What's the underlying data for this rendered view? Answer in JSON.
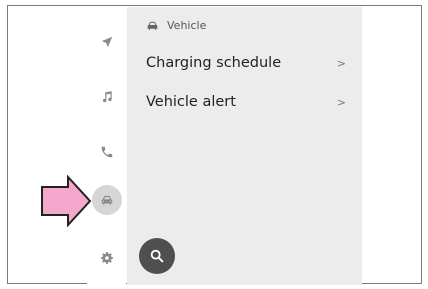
{
  "header": {
    "icon": "car-icon",
    "title": "Vehicle"
  },
  "menu": [
    {
      "label": "Charging schedule",
      "chevron": ">"
    },
    {
      "label": "Vehicle alert",
      "chevron": ">"
    }
  ],
  "rail": [
    {
      "icon": "navigation-arrow-icon"
    },
    {
      "icon": "music-note-icon"
    },
    {
      "icon": "phone-icon"
    },
    {
      "icon": "car-icon",
      "active": true
    },
    {
      "icon": "gear-icon"
    }
  ],
  "search": {
    "icon": "search-icon"
  },
  "callout": {
    "icon": "pointer-arrow",
    "color": "#f4a9cc"
  },
  "colors": {
    "panel": "#ececec",
    "rail_icon": "#8a8a8a",
    "active_bubble": "#d6d6d6",
    "search_button": "#4f4f4f"
  }
}
